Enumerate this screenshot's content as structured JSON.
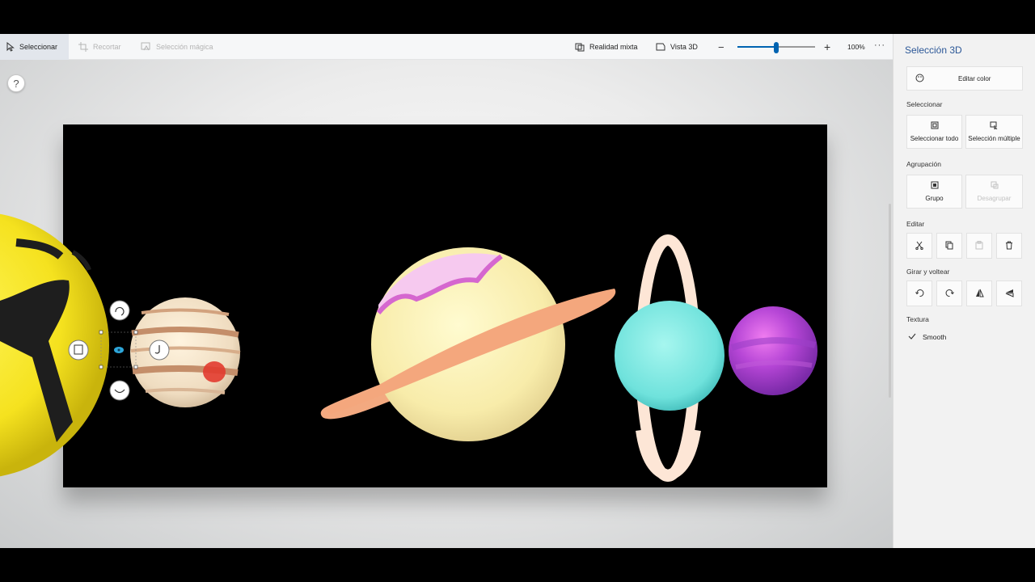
{
  "toolbar": {
    "select_label": "Seleccionar",
    "crop_label": "Recortar",
    "magic_select_label": "Selección mágica",
    "mixed_reality_label": "Realidad mixta",
    "view3d_label": "Vista 3D",
    "zoom_level": "100%",
    "zoom_fraction": 0.5,
    "more_label": "···"
  },
  "help": {
    "label": "?"
  },
  "panel": {
    "title": "Selección 3D",
    "edit_color_label": "Editar color",
    "select_section": "Seleccionar",
    "select_all_label": "Seleccionar todo",
    "multi_select_label": "Selección múltiple",
    "grouping_section": "Agrupación",
    "group_label": "Grupo",
    "ungroup_label": "Desagrupar",
    "edit_section": "Editar",
    "rotate_section": "Girar y voltear",
    "texture_section": "Textura",
    "smooth_label": "Smooth"
  },
  "colors": {
    "accent": "#0063b1",
    "panel_title": "#2b5797",
    "canvas": "#000000"
  },
  "icons": [
    "cursor-icon",
    "crop-icon",
    "magic-select-icon",
    "mixed-reality-icon",
    "view3d-icon",
    "zoom-out-icon",
    "zoom-in-icon",
    "more-icon",
    "palette-icon",
    "select-all-icon",
    "multi-select-icon",
    "group-icon",
    "ungroup-icon",
    "cut-icon",
    "copy-icon",
    "paste-icon",
    "delete-icon",
    "rotate-left-icon",
    "rotate-right-icon",
    "flip-horizontal-icon",
    "flip-vertical-icon",
    "check-icon"
  ]
}
